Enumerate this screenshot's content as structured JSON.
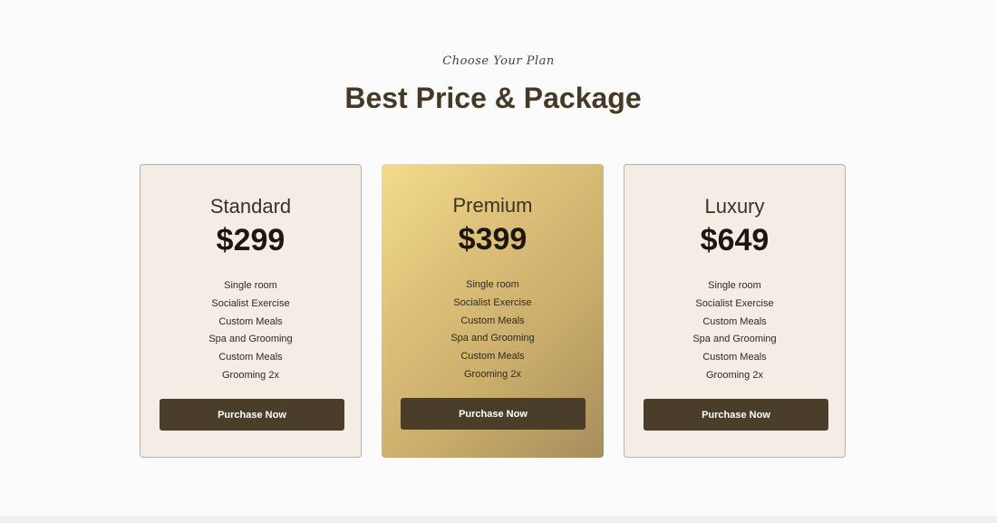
{
  "header": {
    "eyebrow": "Choose Your Plan",
    "title": "Best Price & Package"
  },
  "plans": [
    {
      "name": "Standard",
      "price": "$299",
      "features": [
        "Single room",
        "Socialist Exercise",
        "Custom Meals",
        "Spa and Grooming",
        "Custom Meals",
        "Grooming 2x"
      ],
      "button_label": "Purchase Now"
    },
    {
      "name": "Premium",
      "price": "$399",
      "features": [
        "Single room",
        "Socialist Exercise",
        "Custom Meals",
        "Spa and Grooming",
        "Custom Meals",
        "Grooming 2x"
      ],
      "button_label": "Purchase Now"
    },
    {
      "name": "Luxury",
      "price": "$649",
      "features": [
        "Single room",
        "Socialist Exercise",
        "Custom Meals",
        "Spa and Grooming",
        "Custom Meals",
        "Grooming 2x"
      ],
      "button_label": "Purchase Now"
    }
  ],
  "colors": {
    "background": "#fbfbfb",
    "card_plain": "#f3ede6",
    "card_featured_start": "#f3dc8d",
    "card_featured_end": "#a68d5d",
    "heading": "#463927",
    "button": "#4a3e2b",
    "button_text": "#ffffff"
  }
}
